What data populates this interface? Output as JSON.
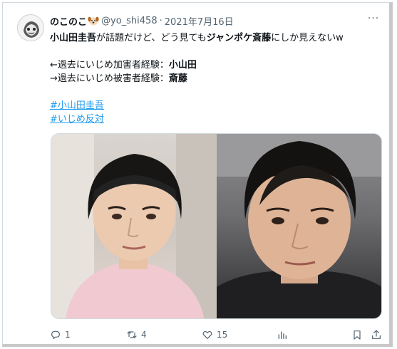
{
  "tweet": {
    "display_name": "のこのこ",
    "handle": "@yo_shi458",
    "separator": "·",
    "date": "2021年7月16日",
    "more_label": "···",
    "line1_part1": "小山田圭吾",
    "line1_part2": "が話題だけど、どう見ても",
    "line1_part3": "ジャンポケ斎藤",
    "line1_part4": "にしか見えないw",
    "line2_label": "←過去にいじめ加害者経験：",
    "line2_value": "小山田",
    "line3_label": "→過去にいじめ被害者経験：",
    "line3_value": "斎藤",
    "hashtags": [
      "#小山田圭吾",
      "#いじめ反対"
    ]
  },
  "actions": {
    "reply_count": "1",
    "retweet_count": "4",
    "like_count": "15"
  },
  "icons": {
    "avatar": "avatar-icon",
    "dog": "dog-emoji-icon",
    "reply": "reply-icon",
    "retweet": "retweet-icon",
    "like": "heart-icon",
    "views": "analytics-icon",
    "bookmark": "bookmark-icon",
    "share": "share-icon"
  },
  "colors": {
    "link": "#1d9bf0",
    "secondary_text": "#536471",
    "primary_text": "#0f1419"
  }
}
